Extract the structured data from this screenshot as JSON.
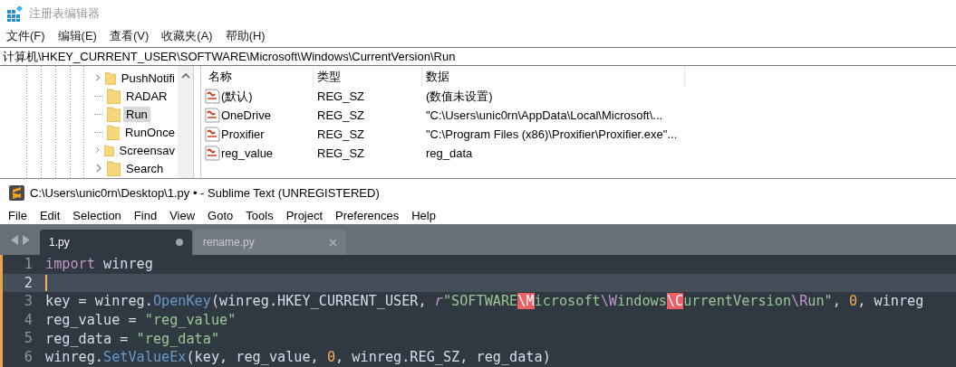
{
  "registry": {
    "title": "注册表编辑器",
    "menu": [
      "文件(F)",
      "编辑(E)",
      "查看(V)",
      "收藏夹(A)",
      "帮助(H)"
    ],
    "address": "计算机\\HKEY_CURRENT_USER\\SOFTWARE\\Microsoft\\Windows\\CurrentVersion\\Run",
    "tree": [
      {
        "label": "PushNotifi",
        "expandable": true,
        "selected": false
      },
      {
        "label": "RADAR",
        "expandable": false,
        "selected": false
      },
      {
        "label": "Run",
        "expandable": false,
        "selected": true
      },
      {
        "label": "RunOnce",
        "expandable": false,
        "selected": false
      },
      {
        "label": "Screensav",
        "expandable": true,
        "selected": false
      },
      {
        "label": "Search",
        "expandable": true,
        "selected": false
      }
    ],
    "columns": [
      "名称",
      "类型",
      "数据"
    ],
    "values": [
      {
        "name": "(默认)",
        "type": "REG_SZ",
        "data": "(数值未设置)"
      },
      {
        "name": "OneDrive",
        "type": "REG_SZ",
        "data": "\"C:\\Users\\unic0rn\\AppData\\Local\\Microsoft\\..."
      },
      {
        "name": "Proxifier",
        "type": "REG_SZ",
        "data": "\"C:\\Program Files (x86)\\Proxifier\\Proxifier.exe\"..."
      },
      {
        "name": "reg_value",
        "type": "REG_SZ",
        "data": "reg_data"
      }
    ]
  },
  "editor": {
    "title": "C:\\Users\\unic0rn\\Desktop\\1.py • - Sublime Text (UNREGISTERED)",
    "menu": [
      "File",
      "Edit",
      "Selection",
      "Find",
      "View",
      "Goto",
      "Tools",
      "Project",
      "Preferences",
      "Help"
    ],
    "tabs": [
      {
        "label": "1.py",
        "selected": true,
        "dirty": true
      },
      {
        "label": "rename.py",
        "selected": false,
        "dirty": false
      }
    ],
    "lines": [
      {
        "number": "1",
        "active": false,
        "tokens": [
          {
            "t": "import",
            "kind": "keyword"
          },
          {
            "t": " winreg",
            "kind": "plain"
          }
        ]
      },
      {
        "number": "2",
        "active": true
      },
      {
        "number": "3",
        "active": false,
        "tokens": [
          {
            "t": "key = winreg.",
            "kind": "plain"
          },
          {
            "t": "OpenKey",
            "kind": "func"
          },
          {
            "t": "(winreg.HKEY_CURRENT_USER, ",
            "kind": "plain"
          },
          {
            "t": "r",
            "kind": "storage"
          },
          {
            "t": "\"SOFTWARE",
            "kind": "string"
          },
          {
            "t": "\\M",
            "kind": "invalid"
          },
          {
            "t": "icrosoft",
            "kind": "string"
          },
          {
            "t": "\\W",
            "kind": "escape"
          },
          {
            "t": "indows",
            "kind": "string"
          },
          {
            "t": "\\C",
            "kind": "invalid"
          },
          {
            "t": "urrentVersion",
            "kind": "string"
          },
          {
            "t": "\\R",
            "kind": "escape"
          },
          {
            "t": "un\"",
            "kind": "string"
          },
          {
            "t": ", ",
            "kind": "plain"
          },
          {
            "t": "0",
            "kind": "number"
          },
          {
            "t": ", winreg",
            "kind": "plain"
          }
        ]
      },
      {
        "number": "4",
        "active": false,
        "tokens": [
          {
            "t": "reg_value = ",
            "kind": "plain"
          },
          {
            "t": "\"reg_value\"",
            "kind": "string"
          }
        ]
      },
      {
        "number": "5",
        "active": false,
        "tokens": [
          {
            "t": "reg_data = ",
            "kind": "plain"
          },
          {
            "t": "\"reg_data\"",
            "kind": "string"
          }
        ]
      },
      {
        "number": "6",
        "active": false,
        "tokens": [
          {
            "t": "winreg.",
            "kind": "plain"
          },
          {
            "t": "SetValueEx",
            "kind": "func"
          },
          {
            "t": "(key, reg_value, ",
            "kind": "plain"
          },
          {
            "t": "0",
            "kind": "number"
          },
          {
            "t": ", winreg.REG_SZ, reg_data)",
            "kind": "plain"
          }
        ]
      }
    ]
  }
}
